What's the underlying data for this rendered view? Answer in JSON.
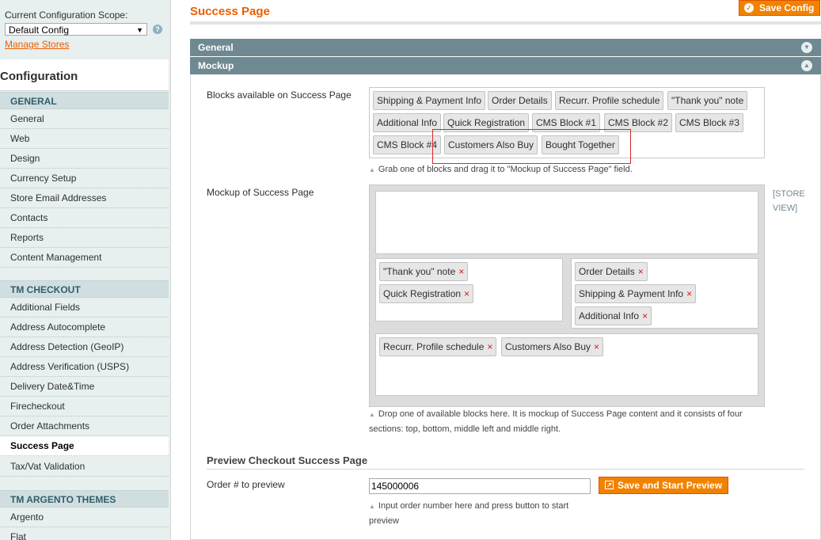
{
  "sidebar": {
    "scope_label": "Current Configuration Scope:",
    "scope_value": "Default Config",
    "manage_stores": "Manage Stores",
    "heading": "Configuration",
    "groups": [
      {
        "title": "GENERAL",
        "items": [
          "General",
          "Web",
          "Design",
          "Currency Setup",
          "Store Email Addresses",
          "Contacts",
          "Reports",
          "Content Management"
        ]
      },
      {
        "title": "TM CHECKOUT",
        "items": [
          "Additional Fields",
          "Address Autocomplete",
          "Address Detection (GeoIP)",
          "Address Verification (USPS)",
          "Delivery Date&Time",
          "Firecheckout",
          "Order Attachments",
          "Success Page",
          "Tax/Vat Validation"
        ]
      },
      {
        "title": "TM ARGENTO THEMES",
        "items": [
          "Argento",
          "Flat"
        ]
      }
    ],
    "active_item": "Success Page"
  },
  "header": {
    "title": "Success Page",
    "save_button": "Save Config"
  },
  "sections": {
    "general": "General",
    "mockup": "Mockup"
  },
  "available": {
    "label": "Blocks available on Success Page",
    "blocks": [
      "Shipping & Payment Info",
      "Order Details",
      "Recurr. Profile schedule",
      "\"Thank you\" note",
      "Additional Info",
      "Quick Registration",
      "CMS Block #1",
      "CMS Block #2",
      "CMS Block #3",
      "CMS Block #4",
      "Customers Also Buy",
      "Bought Together"
    ],
    "note": "Grab one of blocks and drag it to \"Mockup of Success Page\" field."
  },
  "mockup": {
    "label": "Mockup of Success Page",
    "scope": "[STORE VIEW]",
    "top": [],
    "middle_left": [
      "\"Thank you\" note",
      "Quick Registration"
    ],
    "middle_right": [
      "Order Details",
      "Shipping & Payment Info",
      "Additional Info"
    ],
    "bottom": [
      "Recurr. Profile schedule",
      "Customers Also Buy"
    ],
    "remove_symbol": "×",
    "note": "Drop one of available blocks here. It is mockup of Success Page content and it consists of four sections: top, bottom, middle left and middle right."
  },
  "preview": {
    "heading": "Preview Checkout Success Page",
    "order_label": "Order # to preview",
    "order_value": "145000006",
    "button": "Save and Start Preview",
    "note": "Input order number here and press button to start preview"
  },
  "colors": {
    "accent": "#eb5e00",
    "button": "#f18200",
    "section_bar": "#6f8992",
    "highlight": "#d9272e"
  }
}
